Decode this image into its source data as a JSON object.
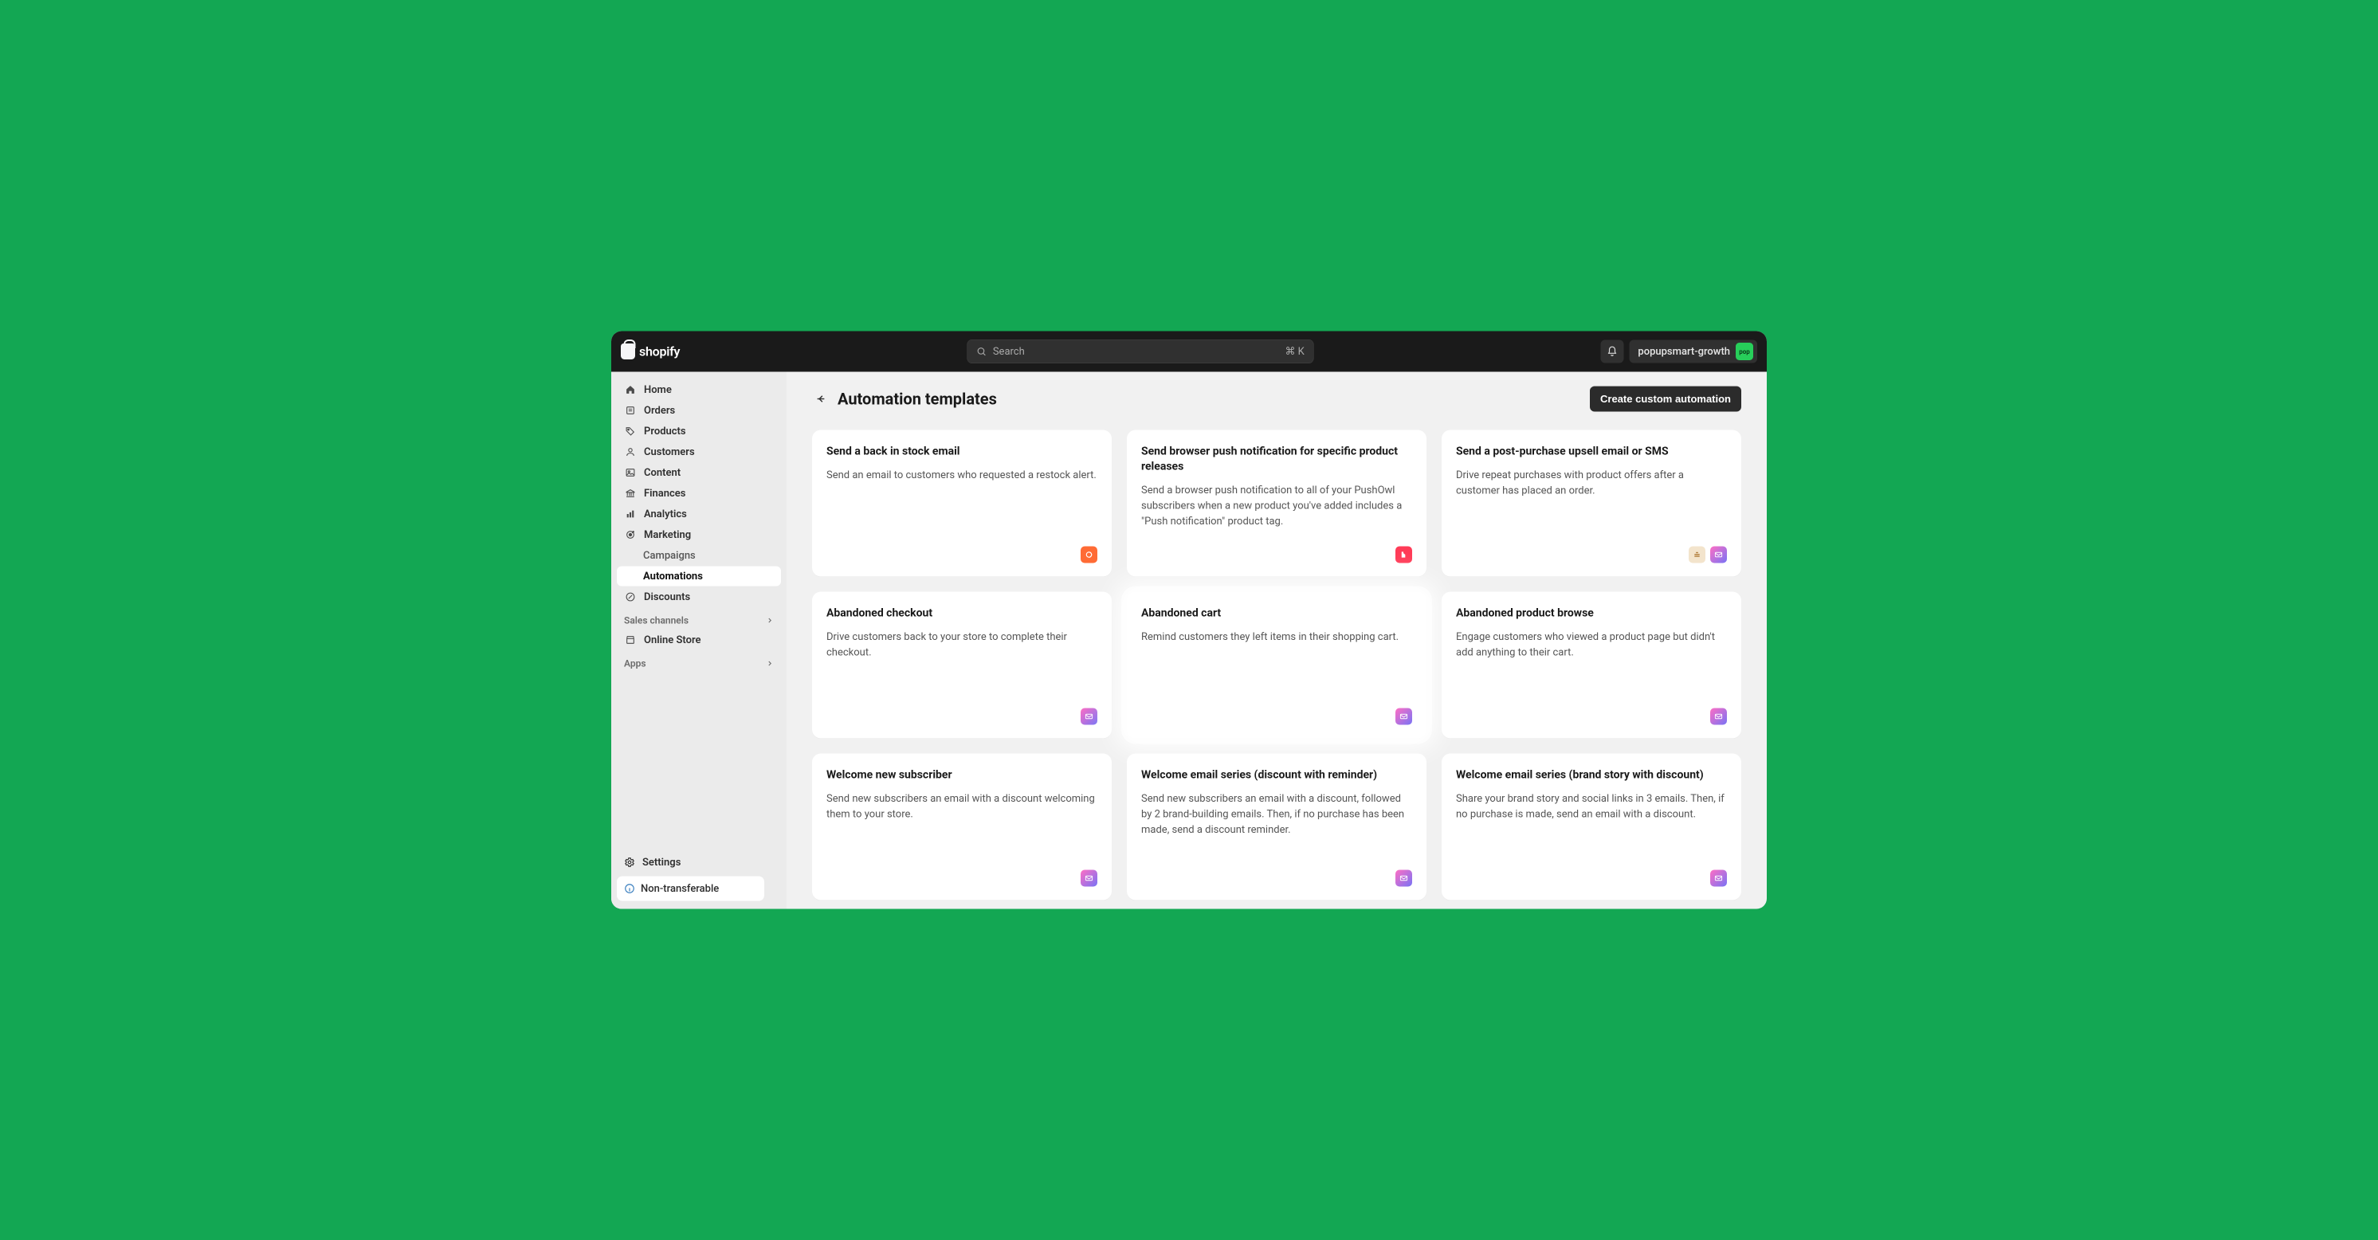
{
  "topbar": {
    "logo_text": "shopify",
    "search_placeholder": "Search",
    "shortcut": "⌘ K",
    "store_name": "popupsmart-growth",
    "avatar_initials": "pop"
  },
  "sidebar": {
    "items": [
      {
        "label": "Home"
      },
      {
        "label": "Orders"
      },
      {
        "label": "Products"
      },
      {
        "label": "Customers"
      },
      {
        "label": "Content"
      },
      {
        "label": "Finances"
      },
      {
        "label": "Analytics"
      },
      {
        "label": "Marketing"
      }
    ],
    "marketing_sub": [
      {
        "label": "Campaigns"
      },
      {
        "label": "Automations"
      }
    ],
    "discounts_label": "Discounts",
    "sales_channels_label": "Sales channels",
    "online_store_label": "Online Store",
    "apps_label": "Apps",
    "settings_label": "Settings",
    "non_transferable_label": "Non-transferable"
  },
  "page": {
    "title": "Automation templates",
    "create_btn": "Create custom automation"
  },
  "cards": [
    {
      "title": "Send a back in stock email",
      "desc": "Send an email to customers who requested a restock alert.",
      "badges": [
        "orange"
      ]
    },
    {
      "title": "Send browser push notification for specific product releases",
      "desc": "Send a browser push notification to all of your PushOwl subscribers when a new product you've added includes a \"Push notification\" product tag.",
      "badges": [
        "red"
      ]
    },
    {
      "title": "Send a post-purchase upsell email or SMS",
      "desc": "Drive repeat purchases with product offers after a customer has placed an order.",
      "badges": [
        "tan",
        "mail"
      ]
    },
    {
      "title": "Abandoned checkout",
      "desc": "Drive customers back to your store to complete their checkout.",
      "badges": [
        "mail"
      ]
    },
    {
      "title": "Abandoned cart",
      "desc": "Remind customers they left items in their shopping cart.",
      "badges": [
        "mail"
      ],
      "highlight": true
    },
    {
      "title": "Abandoned product browse",
      "desc": "Engage customers who viewed a product page but didn't add anything to their cart.",
      "badges": [
        "mail"
      ]
    },
    {
      "title": "Welcome new subscriber",
      "desc": "Send new subscribers an email with a discount welcoming them to your store.",
      "badges": [
        "mail"
      ]
    },
    {
      "title": "Welcome email series (discount with reminder)",
      "desc": "Send new subscribers an email with a discount, followed by 2 brand-building emails. Then, if no purchase has been made, send a discount reminder.",
      "badges": [
        "mail"
      ]
    },
    {
      "title": "Welcome email series (brand story with discount)",
      "desc": "Share your brand story and social links in 3 emails. Then, if no purchase is made, send an email with a discount.",
      "badges": [
        "mail"
      ]
    }
  ]
}
